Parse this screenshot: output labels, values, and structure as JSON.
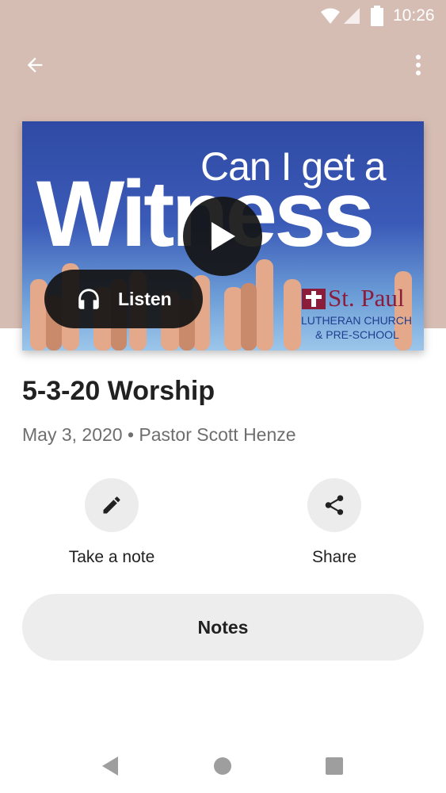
{
  "status_bar": {
    "time": "10:26",
    "icons": [
      "wifi-icon",
      "signal-icon",
      "battery-icon"
    ]
  },
  "app_bar": {
    "back_icon": "arrow-back-icon",
    "menu_icon": "more-vert-icon"
  },
  "artwork": {
    "tagline": "Can I get a",
    "headline": "Witness",
    "logo": {
      "name": "St. Paul",
      "line1": "LUTHERAN CHURCH",
      "line2": "& PRE-SCHOOL"
    }
  },
  "player": {
    "play_icon": "play-icon",
    "listen_label": "Listen",
    "listen_icon": "headphones-icon"
  },
  "sermon": {
    "title": "5-3-20 Worship",
    "meta": "May 3, 2020 • Pastor Scott Henze"
  },
  "actions": [
    {
      "label": "Take a note",
      "icon": "pencil-icon"
    },
    {
      "label": "Share",
      "icon": "share-icon"
    }
  ],
  "notes_button": {
    "label": "Notes"
  },
  "nav_bar": {
    "icons": [
      "back-triangle-icon",
      "home-circle-icon",
      "recents-square-icon"
    ]
  },
  "colors": {
    "header_bg": "#d6bdb3",
    "button_bg": "#ececec",
    "overlay_dark": "#141414"
  }
}
